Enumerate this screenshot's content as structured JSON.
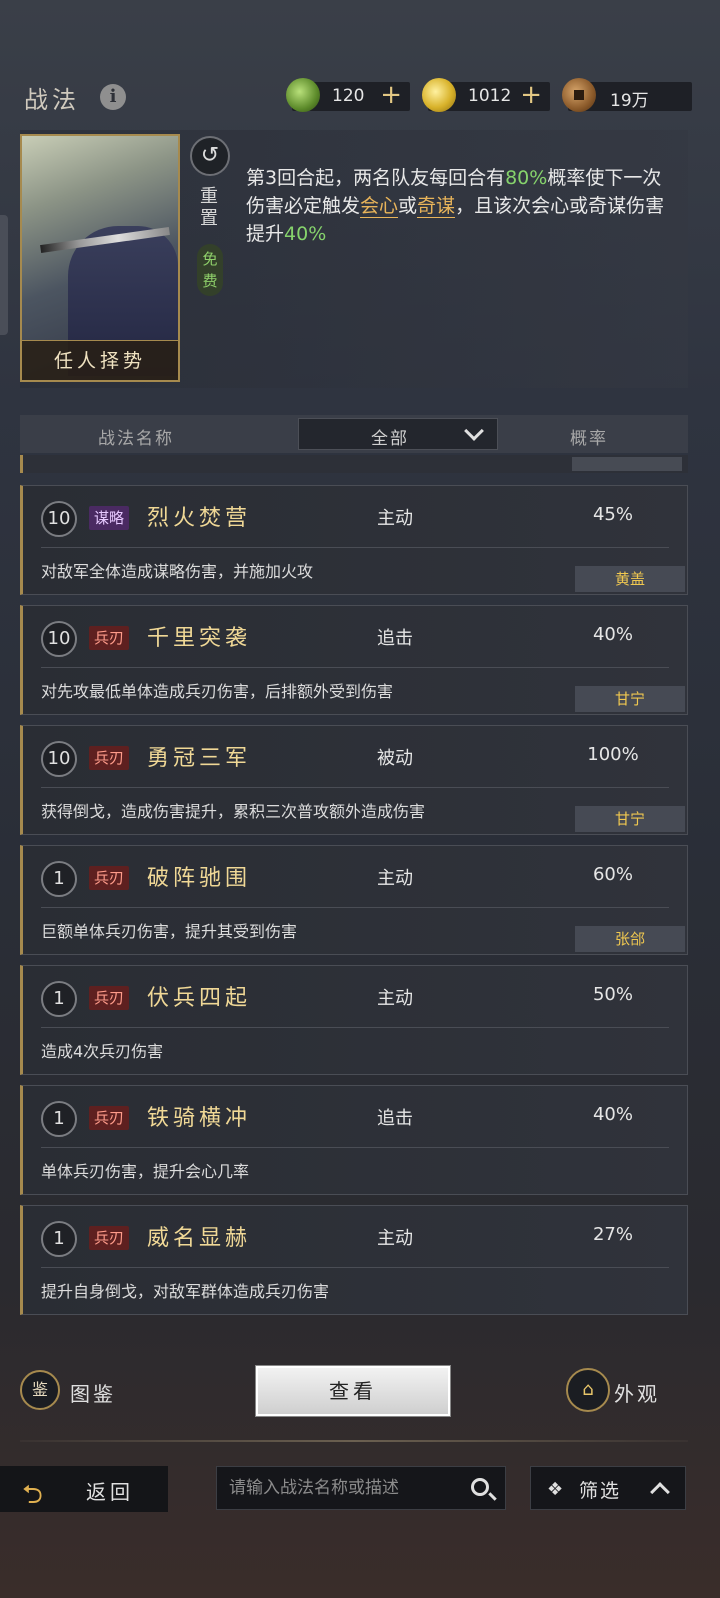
{
  "header": {
    "title": "战法",
    "info_icon": "info-icon",
    "resources": [
      {
        "icon": "jade-coin-icon",
        "value": "120",
        "has_plus": true
      },
      {
        "icon": "gold-coin-icon",
        "value": "1012",
        "has_plus": true
      },
      {
        "icon": "copper-coin-icon",
        "value": "19万",
        "has_plus": false
      }
    ]
  },
  "detail": {
    "card_name": "任人择势",
    "reset_label": "重置",
    "free_label": "免费",
    "description": {
      "p1": "第3回合起，两名队友每回合有",
      "rate1": "80%",
      "p2": "概率使下一次伤害必定触发",
      "kw1": "会心",
      "p3": "或",
      "kw2": "奇谋",
      "p4": "，且该次会心或奇谋伤害提升",
      "rate2": "40%"
    }
  },
  "list_header": {
    "name_col": "战法名称",
    "filter_value": "全部",
    "rate_col": "概率"
  },
  "skills": [
    {
      "level": "10",
      "type": "谋略",
      "type_class": "type-ce",
      "name": "烈火焚营",
      "kind": "主动",
      "rate": "45%",
      "desc": "对敌军全体造成谋略伤害，并施加火攻",
      "hero": "黄盖"
    },
    {
      "level": "10",
      "type": "兵刃",
      "type_class": "type-bing",
      "name": "千里突袭",
      "kind": "追击",
      "rate": "40%",
      "desc": "对先攻最低单体造成兵刃伤害，后排额外受到伤害",
      "hero": "甘宁"
    },
    {
      "level": "10",
      "type": "兵刃",
      "type_class": "type-bing",
      "name": "勇冠三军",
      "kind": "被动",
      "rate": "100%",
      "desc": "获得倒戈，造成伤害提升，累积三次普攻额外造成伤害",
      "hero": "甘宁"
    },
    {
      "level": "1",
      "type": "兵刃",
      "type_class": "type-bing",
      "name": "破阵驰围",
      "kind": "主动",
      "rate": "60%",
      "desc": "巨额单体兵刃伤害，提升其受到伤害",
      "hero": "张郃"
    },
    {
      "level": "1",
      "type": "兵刃",
      "type_class": "type-bing",
      "name": "伏兵四起",
      "kind": "主动",
      "rate": "50%",
      "desc": "造成4次兵刃伤害",
      "hero": ""
    },
    {
      "level": "1",
      "type": "兵刃",
      "type_class": "type-bing",
      "name": "铁骑横冲",
      "kind": "追击",
      "rate": "40%",
      "desc": "单体兵刃伤害，提升会心几率",
      "hero": ""
    },
    {
      "level": "1",
      "type": "兵刃",
      "type_class": "type-bing",
      "name": "威名显赫",
      "kind": "主动",
      "rate": "27%",
      "desc": "提升自身倒戈，对敌军群体造成兵刃伤害",
      "hero": ""
    }
  ],
  "bottom": {
    "tujian_label": "图鉴",
    "view_label": "查看",
    "waiguan_label": "外观"
  },
  "footer": {
    "back_label": "返回",
    "search_placeholder": "请输入战法名称或描述",
    "filter_label": "筛选"
  },
  "colors": {
    "accent_gold": "#a68a4e",
    "highlight_green": "#86d36c",
    "highlight_orange": "#e8b45a",
    "hero_tag": "#f0c850"
  }
}
